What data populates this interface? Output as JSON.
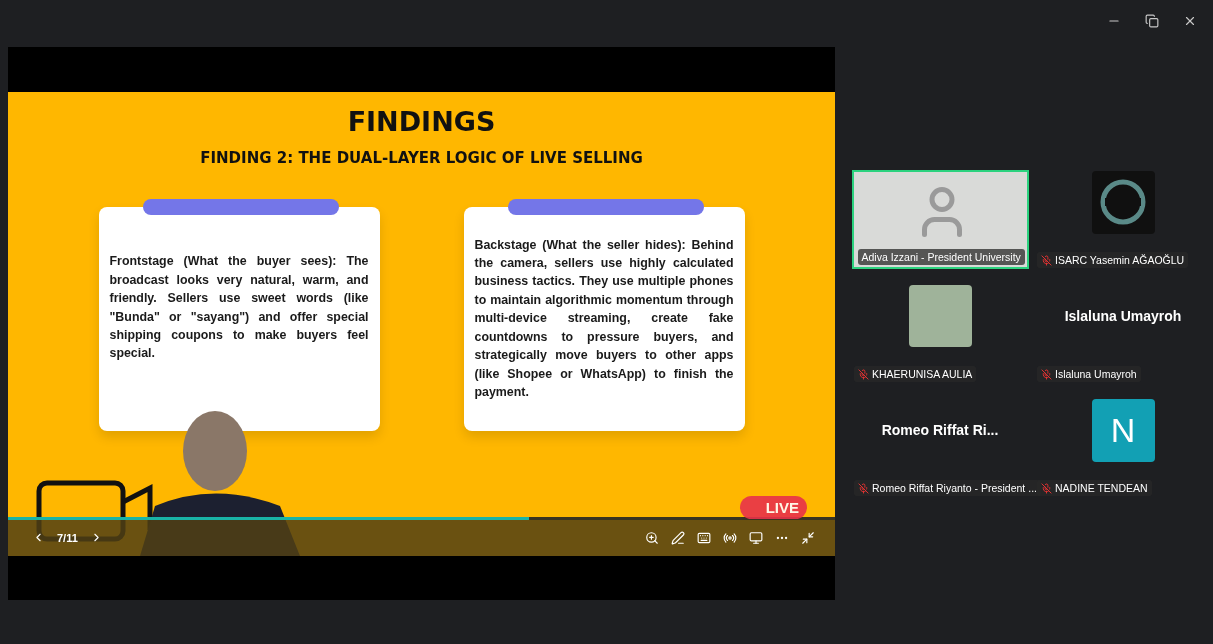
{
  "slide": {
    "title": "FINDINGS",
    "subtitle": "FINDING 2: THE DUAL-LAYER LOGIC OF LIVE SELLING",
    "cards": [
      {
        "text": "Frontstage (What the buyer sees): The broadcast looks very natural, warm, and friendly. Sellers use sweet words (like \"Bunda\" or \"sayang\") and offer special shipping coupons to make buyers feel special."
      },
      {
        "text": "Backstage (What the seller hides): Behind the camera, sellers use highly calculated business tactics. They use multiple phones to maintain algorithmic momentum through multi-device streaming, create fake countdowns to pressure buyers, and strategically move buyers to other apps (like Shopee or WhatsApp) to finish the payment."
      }
    ]
  },
  "player": {
    "page": "7/11",
    "progress": {
      "level": 0.63
    },
    "live_badge": "LIVE"
  },
  "participants": [
    {
      "kind": "video",
      "name": "Adiva Izzani - President University",
      "muted": false,
      "speaking": true
    },
    {
      "kind": "logo",
      "name": "ISARC Yasemin AĞAOĞLU",
      "muted": true,
      "speaking": false
    },
    {
      "kind": "photo",
      "name": "KHAERUNISA AULIA",
      "muted": true,
      "speaking": false
    },
    {
      "kind": "name",
      "display": "Islaluna Umayroh",
      "name": "Islaluna Umayroh",
      "muted": true,
      "speaking": false
    },
    {
      "kind": "name",
      "display": "Romeo  Riffat  Ri...",
      "name": "Romeo Riffat Riyanto - President ...",
      "muted": true,
      "speaking": false
    },
    {
      "kind": "initial",
      "display": "N",
      "color": "#12a0b4",
      "name": "NADINE TENDEAN",
      "muted": true,
      "speaking": false
    }
  ]
}
